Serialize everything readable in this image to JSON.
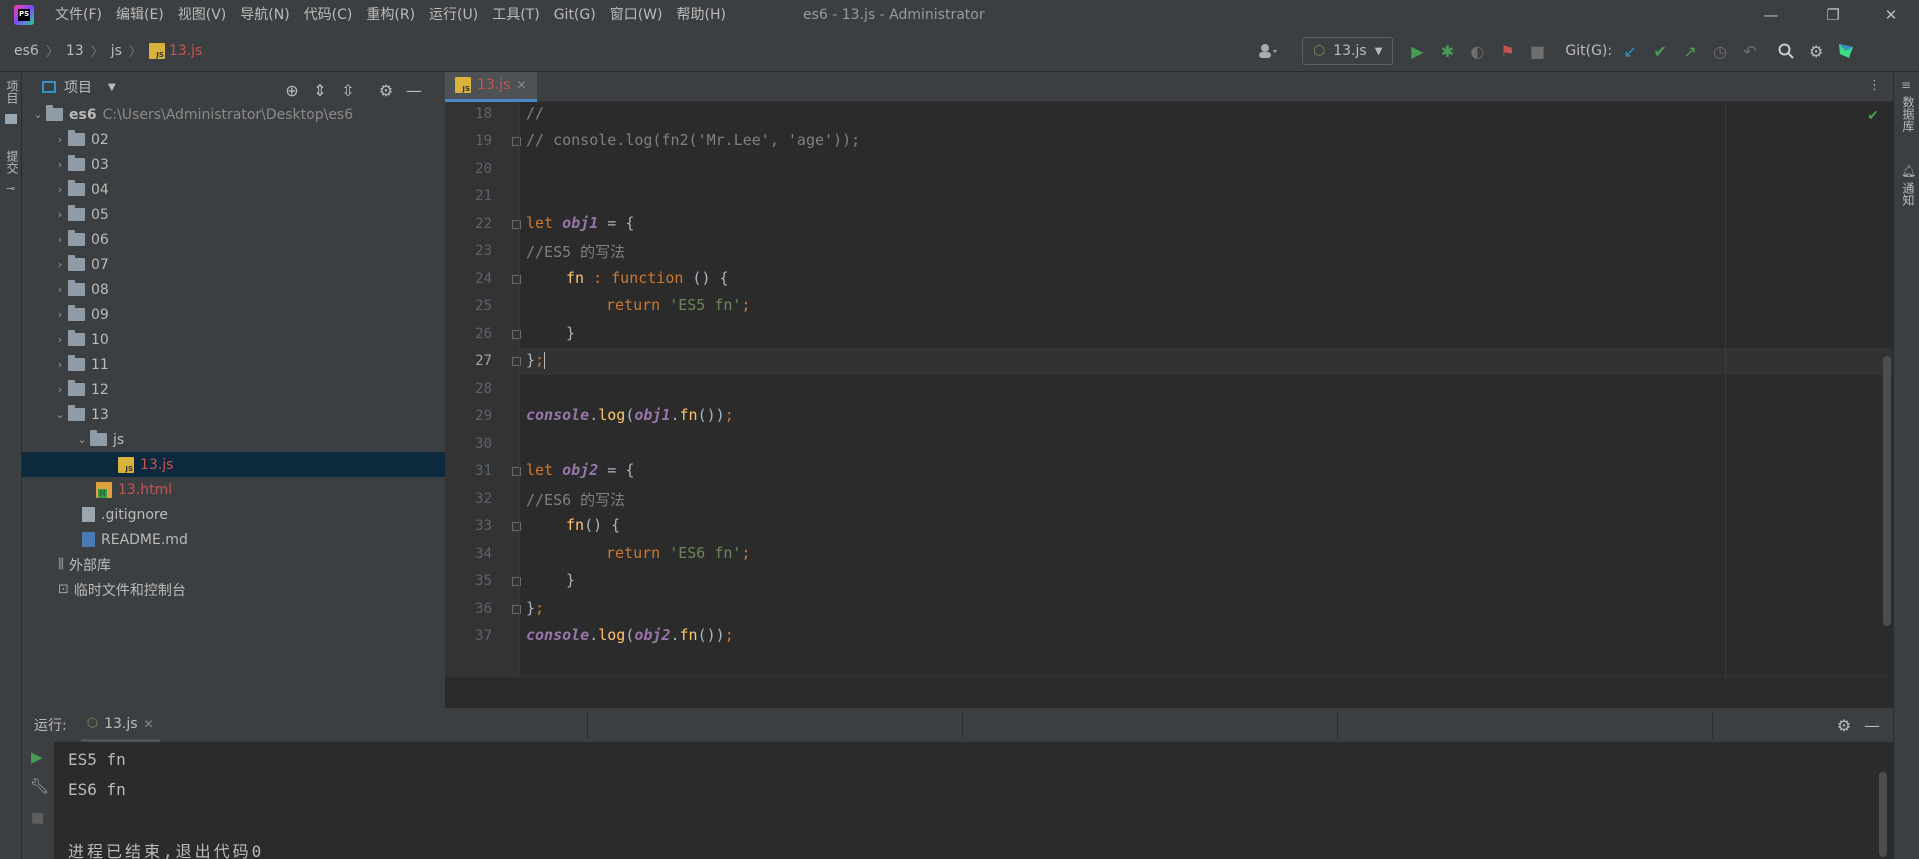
{
  "app": {
    "logo_text": "PS",
    "window_title": "es6 - 13.js - Administrator",
    "menu": [
      "文件(F)",
      "编辑(E)",
      "视图(V)",
      "导航(N)",
      "代码(C)",
      "重构(R)",
      "运行(U)",
      "工具(T)",
      "Git(G)",
      "窗口(W)",
      "帮助(H)"
    ],
    "controls": {
      "minimize": "—",
      "restore": "❐",
      "close": "✕"
    }
  },
  "navbar": {
    "breadcrumbs": [
      "es6",
      "13",
      "js",
      "13.js"
    ],
    "run_config": "13.js",
    "git_label": "Git(G):"
  },
  "left_strip": {
    "project": "项目",
    "commit": "提交"
  },
  "right_strip": {
    "database": "数据库",
    "notifications": "通知"
  },
  "project_panel": {
    "title": "项目",
    "root": {
      "name": "es6",
      "path": "C:\\Users\\Administrator\\Desktop\\es6"
    },
    "folders": [
      "02",
      "03",
      "04",
      "05",
      "06",
      "07",
      "08",
      "09",
      "10",
      "11",
      "12",
      "13"
    ],
    "subfolder": "js",
    "selected_file": "13.js",
    "html_file": "13.html",
    "gitignore": ".gitignore",
    "readme": "README.md",
    "external_libs": "外部库",
    "scratches": "临时文件和控制台"
  },
  "editor": {
    "tab": "13.js",
    "current_line": 27,
    "line_numbers": [
      18,
      19,
      20,
      21,
      22,
      23,
      24,
      25,
      26,
      27,
      28,
      29,
      30,
      31,
      32,
      33,
      34,
      35,
      36,
      37
    ],
    "lines": {
      "l18": "//",
      "l19": "// console.log(fn2('Mr.Lee', 'age'));",
      "l22_kw": "let ",
      "l22_var": "obj1",
      "l22_rest": " = {",
      "l23": "//ES5 的写法",
      "l24_fn": "fn",
      "l24_sep": " : ",
      "l24_kw": "function",
      "l24_rest": " () {",
      "l25_kw": "return ",
      "l25_str": "'ES5 fn'",
      "l25_semi": ";",
      "l26": "}",
      "l27_brace": "}",
      "l27_semi": ";",
      "l29_var": "console",
      "l29_dot": ".",
      "l29_fn": "log",
      "l29_open": "(",
      "l29_obj": "obj1",
      "l29_dot2": ".",
      "l29_fn2": "fn",
      "l29_close": "())",
      "l29_semi": ";",
      "l31_kw": "let ",
      "l31_var": "obj2",
      "l31_rest": " = {",
      "l32": "//ES6 的写法",
      "l33_fn": "fn",
      "l33_rest": "() {",
      "l34_kw": "return ",
      "l34_str": "'ES6 fn'",
      "l34_semi": ";",
      "l35": "}",
      "l36_brace": "}",
      "l36_semi": ";",
      "l37_var": "console",
      "l37_dot": ".",
      "l37_fn": "log",
      "l37_open": "(",
      "l37_obj": "obj2",
      "l37_dot2": ".",
      "l37_fn2": "fn",
      "l37_close": "())",
      "l37_semi": ";"
    }
  },
  "run_panel": {
    "label": "运行:",
    "tab": "13.js",
    "output": [
      "ES5 fn",
      "ES6 fn",
      "",
      "进程已结束,退出代码0"
    ]
  },
  "colors": {
    "accent": "#4a88c7",
    "run_green": "#499c54",
    "file_modified": "#c75450",
    "selection": "#0d293e"
  }
}
